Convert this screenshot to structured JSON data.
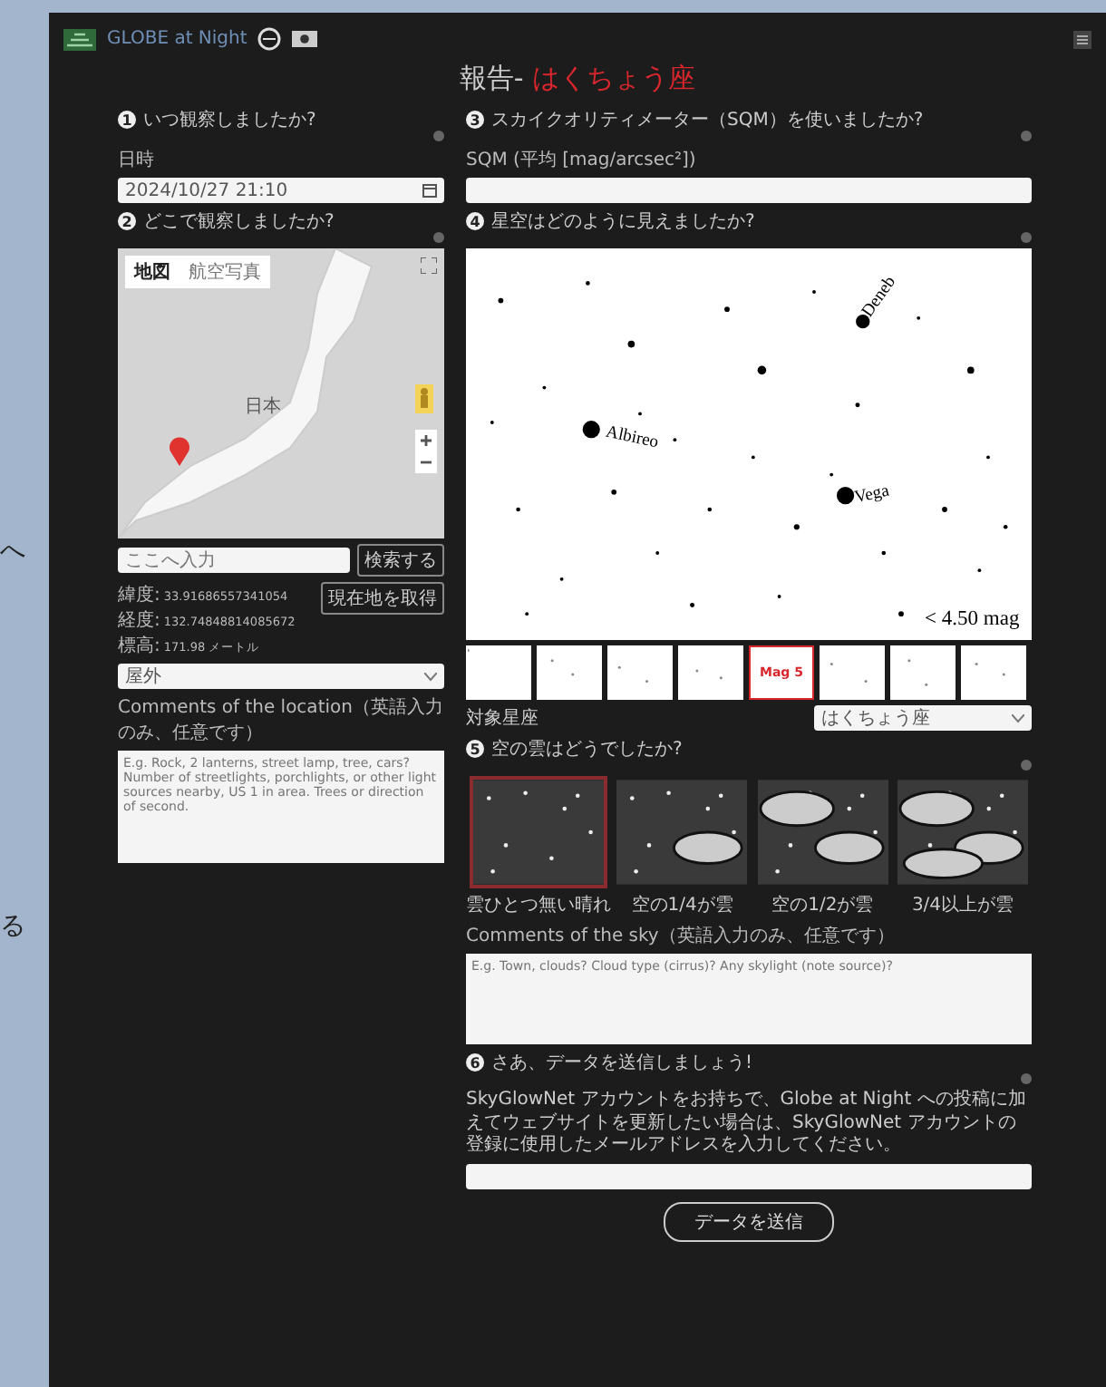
{
  "backdrop_glyphs": [
    "へ",
    "る"
  ],
  "header": {
    "logo": "GLOBE at Night"
  },
  "title": {
    "prefix": "報告- ",
    "constellation": "はくちょう座"
  },
  "left": {
    "when": {
      "num": "1",
      "heading": "いつ観察しましたか?",
      "label": "日時",
      "value": "2024/10/27 21:10"
    },
    "where": {
      "num": "2",
      "heading": "どこで観察しましたか?",
      "map_types": [
        {
          "label": "地図",
          "selected": true
        },
        {
          "label": "航空写真",
          "selected": false
        }
      ],
      "map_label": "日本",
      "search_placeholder": "ここへ入力",
      "search_button": "検索する",
      "coords": [
        {
          "label": "緯度:",
          "value": "33.91686557341054"
        },
        {
          "label": "経度:",
          "value": "132.74848814085672"
        },
        {
          "label": "標高:",
          "value": "171.98 メートル"
        }
      ],
      "locate_button": "現在地を取得",
      "place": "屋外",
      "comment_label": "Comments of the location（英語入力のみ、任意です）",
      "comment_placeholder": "E.g. Rock, 2 lanterns, street lamp, tree, cars? Number of streetlights, porchlights, or other light sources nearby, US 1 in area. Trees or direction of second."
    }
  },
  "right": {
    "sqm": {
      "num": "3",
      "heading": "スカイクオリティメーター（SQM）を使いましたか?",
      "label": "SQM (平均 [mag/arcsec²])"
    },
    "sky": {
      "num": "4",
      "heading": "星空はどのように見えましたか?",
      "star_names": [
        "Deneb",
        "Albireo",
        "Vega"
      ],
      "limit": "< 4.50 mag",
      "thumbnails": [
        {
          "selected": false
        },
        {
          "selected": false
        },
        {
          "selected": false
        },
        {
          "selected": false
        },
        {
          "selected": true,
          "label": "Mag 5"
        },
        {
          "selected": false
        },
        {
          "selected": false
        },
        {
          "selected": false
        }
      ],
      "target_label": "対象星座",
      "target_value": "はくちょう座"
    },
    "clouds": {
      "num": "5",
      "heading": "空の雲はどうでしたか?",
      "options": [
        {
          "label": "雲ひとつ無い晴れ",
          "selected": true
        },
        {
          "label": "空の1/4が雲",
          "selected": false
        },
        {
          "label": "空の1/2が雲",
          "selected": false
        },
        {
          "label": "3/4以上が雲",
          "selected": false
        }
      ],
      "comment_label": "Comments of the sky（英語入力のみ、任意です）",
      "comment_placeholder": "E.g. Town, clouds? Cloud type (cirrus)? Any skylight (note source)?"
    },
    "submit": {
      "num": "6",
      "heading": "さあ、データを送信しましょう!",
      "note": "SkyGlowNet アカウントをお持ちで、Globe at Night への投稿に加えてウェブサイトを更新したい場合は、SkyGlowNet アカウントの登録に使用したメールアドレスを入力してください。",
      "button": "データを送信"
    }
  }
}
